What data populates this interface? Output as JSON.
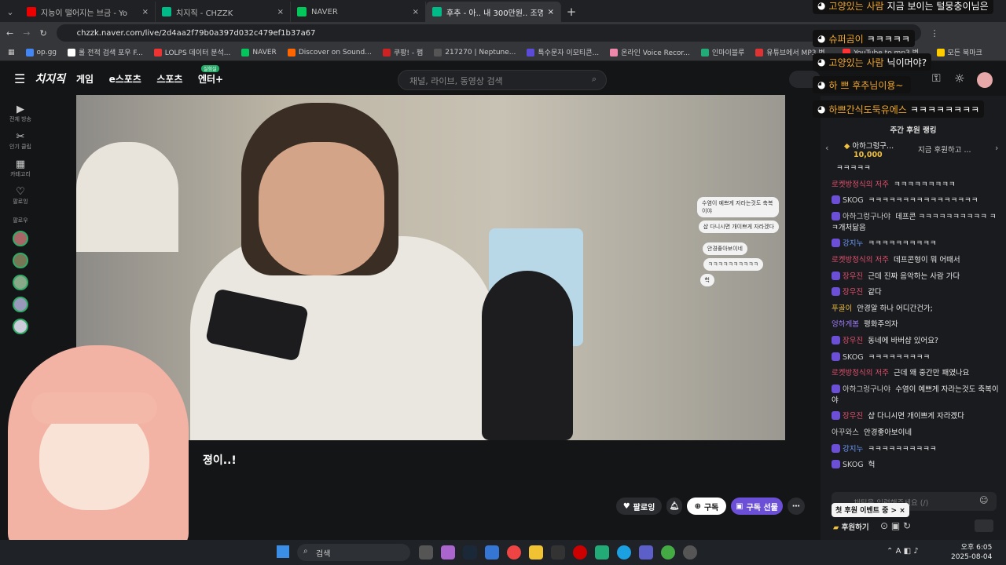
{
  "browser": {
    "tabs": [
      {
        "title": "지능이 떨어지는 브금 - Yo",
        "color": "#f00"
      },
      {
        "title": "치지직 - CHZZK",
        "color": "#0c8"
      },
      {
        "title": "NAVER",
        "color": "#03c75a"
      },
      {
        "title": "후추 - 아.. 내 300만원.. 조명이",
        "color": "#0c8"
      }
    ],
    "url": "chzzk.naver.com/live/2d4aa2f79b0a397d032c479ef1b37a67"
  },
  "bookmarks": [
    "op.gg",
    "롤 전적 검색 포우 F...",
    "LOLPS 데이터 분석...",
    "NAVER",
    "Discover on Sound...",
    "쿠팡! - 쩜",
    "217270 | Neptune...",
    "특수문자 이모티콘...",
    "온라인 Voice Recor...",
    "인마이블루",
    "유튜브에서 MP3 변...",
    "YouTube to mp3 변...",
    "모든 북마크"
  ],
  "site": {
    "nav": [
      "게임",
      "e스포츠",
      "스포츠",
      "엔터+"
    ],
    "enter_badge": "실험실",
    "search_placeholder": "채널, 라이브, 동영상 검색"
  },
  "rail": [
    {
      "icon": "▶",
      "label": "전체 방송"
    },
    {
      "icon": "✂",
      "label": "인기 클립"
    },
    {
      "icon": "▦",
      "label": "카테고리"
    },
    {
      "icon": "♡",
      "label": "팔로잉"
    }
  ],
  "rail_follow": "팔로우",
  "overlay_chat": [
    "수염이 예쁘게 자라는것도 축복이야",
    "샵 다니시면 개이쁘게 자라겠다",
    "안경좋아보이네",
    "ㅋㅋㅋㅋㅋㅋㅋㅋㅋㅋ",
    "헉"
  ],
  "subtitle": "졍이..!",
  "actions": {
    "follow": "팔로잉",
    "subscribe": "구독",
    "gift": "구독 선물"
  },
  "donations": [
    {
      "name": "고양있는 사람",
      "text": "지금 보이는 털뭉충이님은"
    },
    {
      "name": "슈퍼곰이",
      "text": "ㅋㅋㅋㅋㅋ"
    },
    {
      "name": "고양있는 사람",
      "text": "닉이머야?"
    },
    {
      "name": "하 쁘 후추님이용~",
      "text": ""
    },
    {
      "name": "하쁘간식도둑유에스",
      "text": "ㅋㅋㅋㅋㅋㅋㅋㅋ"
    }
  ],
  "ranking": {
    "title": "주간 후원 랭킹",
    "top_name": "아하그렁구...",
    "top_amount": "10,000",
    "now": "지금 후원하고 ..."
  },
  "chat": [
    {
      "n": "",
      "t": "ㅋㅋㅋㅋㅋ",
      "c": "#ccc",
      "b": 0
    },
    {
      "n": "로켓방정식의 저주",
      "t": "ㅋㅋㅋㅋㅋㅋㅋㅋㅋ",
      "c": "#e0506e",
      "b": 0
    },
    {
      "n": "SKOG",
      "t": "ㅋㅋㅋㅋㅋㅋㅋㅋㅋㅋㅋㅋㅋㅋㅋㅋ",
      "c": "#ccc",
      "b": 1
    },
    {
      "n": "아하그렁구나야",
      "t": "데프콘 ㅋㅋㅋㅋㅋㅋㅋㅋㅋㅋ ㅋㅋ개처닮음",
      "c": "#ccc",
      "b": 1
    },
    {
      "n": "강지누",
      "t": "ㅋㅋㅋㅋㅋㅋㅋㅋㅋㅋ",
      "c": "#6b9bff",
      "b": 1
    },
    {
      "n": "로켓방정식의 저주",
      "t": "데프콘형이 뭐 어때서",
      "c": "#e0506e",
      "b": 0
    },
    {
      "n": "장우진",
      "t": "근데 진짜 음악하는 사람 가다",
      "c": "#e0506e",
      "b": 1
    },
    {
      "n": "장우진",
      "t": "같다",
      "c": "#e0506e",
      "b": 1
    },
    {
      "n": "푸골이",
      "t": "안경알 하나 어디간건가;",
      "c": "#f0c040",
      "b": 0
    },
    {
      "n": "엉하게봄",
      "t": "평화주의자",
      "c": "#a07cff",
      "b": 0
    },
    {
      "n": "장우진",
      "t": "동네에 바버샵 있어요?",
      "c": "#e0506e",
      "b": 1
    },
    {
      "n": "SKOG",
      "t": "ㅋㅋㅋㅋㅋㅋㅋㅋㅋ",
      "c": "#ccc",
      "b": 1
    },
    {
      "n": "로켓방정식의 저주",
      "t": "근데 왜 중간만 패였나요",
      "c": "#e0506e",
      "b": 0
    },
    {
      "n": "아하그렁구나야",
      "t": "수염이 예쁘게 자라는것도 축복이야",
      "c": "#ccc",
      "b": 1
    },
    {
      "n": "장우진",
      "t": "샵 다니시면 개이쁘게 자라겠다",
      "c": "#e0506e",
      "b": 1
    },
    {
      "n": "아꾸와스",
      "t": "안경좋아보이네",
      "c": "#ccc",
      "b": 0
    },
    {
      "n": "강지누",
      "t": "ㅋㅋㅋㅋㅋㅋㅋㅋㅋㅋ",
      "c": "#6b9bff",
      "b": 1
    },
    {
      "n": "SKOG",
      "t": "헉",
      "c": "#ccc",
      "b": 1
    }
  ],
  "chat_input": "채팅을 입력해주세요 (/)",
  "event_badge": "첫 후원 이벤트 중 >",
  "donate_btn": "후원하기",
  "taskbar": {
    "search": "검색",
    "time": "오후 6:05",
    "date": "2025-08-04",
    "ime": "A"
  }
}
